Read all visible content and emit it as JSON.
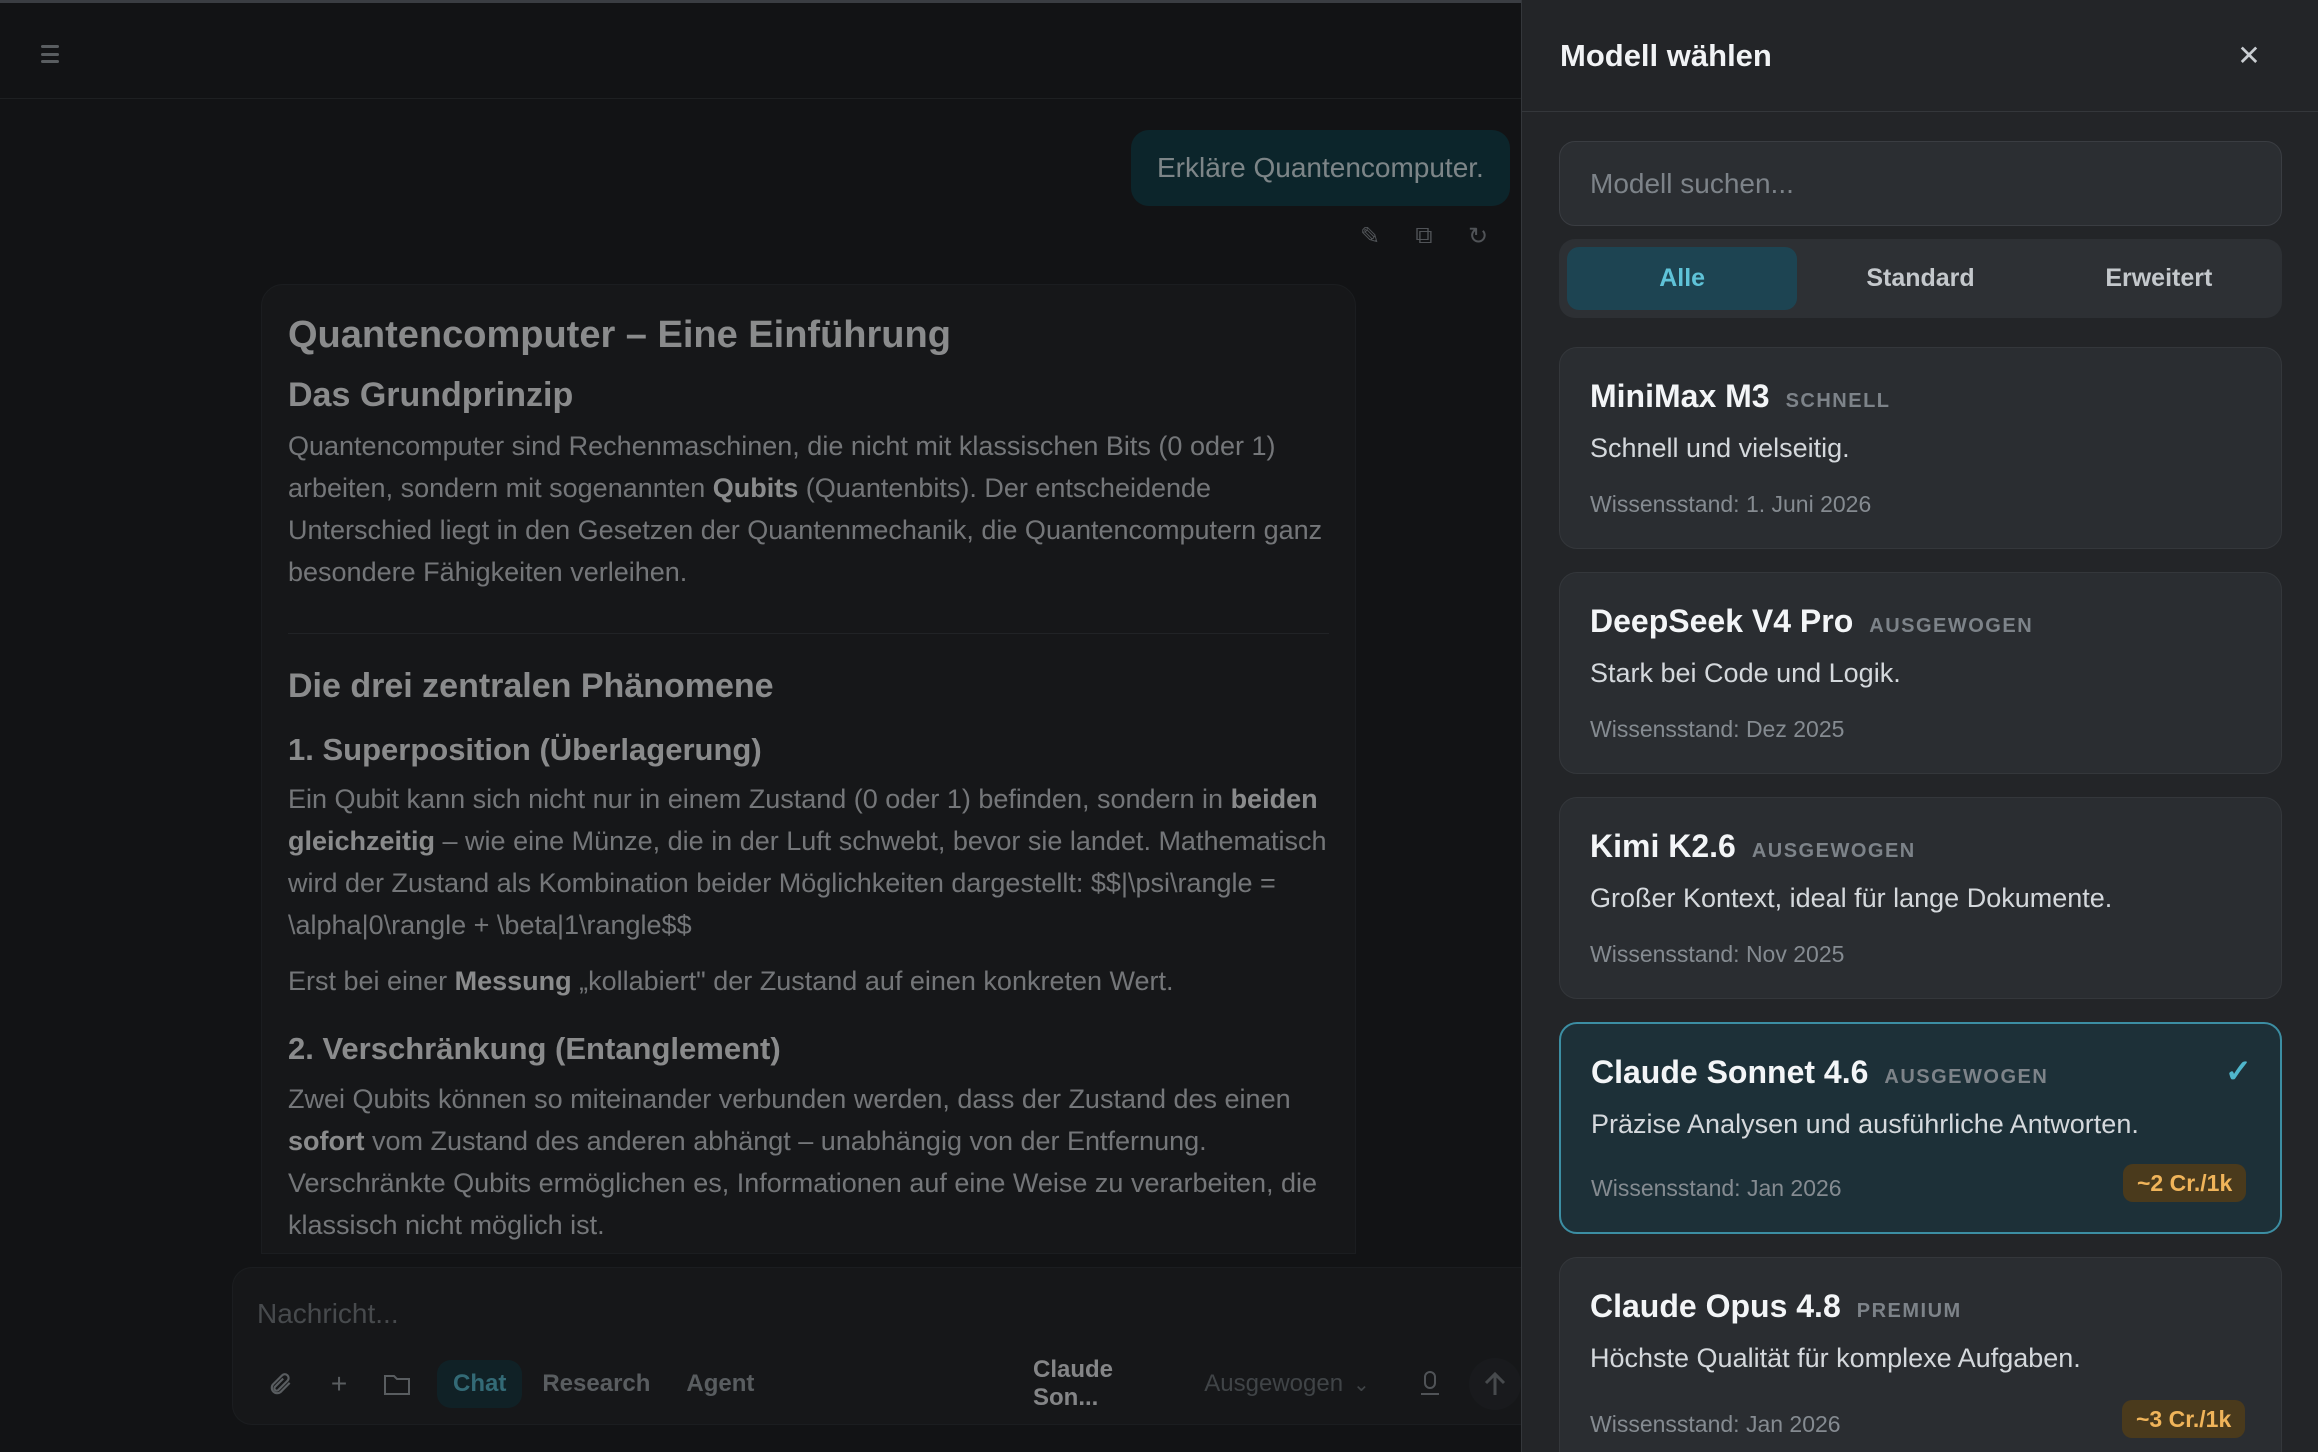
{
  "chat": {
    "user_message": "Erkläre Quantencomputer.",
    "answer": {
      "title": "Quantencomputer – Eine Einführung",
      "section1_title": "Das Grundprinzip",
      "p1_a": "Quantencomputer sind Rechenmaschinen, die nicht mit klassischen Bits (0 oder 1) arbeiten, sondern mit sogenannten ",
      "p1_bold": "Qubits",
      "p1_b": " (Quantenbits). Der entscheidende Unterschied liegt in den Gesetzen der Quantenmechanik, die Quantencomputern ganz besondere Fähigkeiten verleihen.",
      "section2_title": "Die drei zentralen Phänomene",
      "sub1_title": "1. Superposition (Überlagerung)",
      "p2_a": "Ein Qubit kann sich nicht nur in einem Zustand (0 oder 1) befinden, sondern in ",
      "p2_bold": "beiden gleichzeitig",
      "p2_b": " – wie eine Münze, die in der Luft schwebt, bevor sie landet. Mathematisch wird der Zustand als Kombination beider Möglichkeiten dargestellt: $$|\\psi\\rangle = \\alpha|0\\rangle + \\beta|1\\rangle$$",
      "p3_a": "Erst bei einer ",
      "p3_bold": "Messung",
      "p3_b": " „kollabiert\" der Zustand auf einen konkreten Wert.",
      "sub2_title": "2. Verschränkung (Entanglement)",
      "p4_a": "Zwei Qubits können so miteinander verbunden werden, dass der Zustand des einen ",
      "p4_bold": "sofort",
      "p4_b": " vom Zustand des anderen abhängt – unabhängig von der Entfernung. Verschränkte Qubits ermöglichen es, Informationen auf eine Weise zu verarbeiten, die klassisch nicht möglich ist."
    }
  },
  "composer": {
    "placeholder": "Nachricht...",
    "modes": [
      "Chat",
      "Research",
      "Agent"
    ],
    "active_mode": "Chat",
    "model_name": "Claude Son...",
    "model_mode": "Ausgewogen"
  },
  "panel": {
    "title": "Modell wählen",
    "search_placeholder": "Modell suchen...",
    "tabs": [
      "Alle",
      "Standard",
      "Erweitert"
    ],
    "active_tab": "Alle",
    "models": [
      {
        "name": "MiniMax M3",
        "tag": "SCHNELL",
        "desc": "Schnell und vielseitig.",
        "date": "Wissensstand: 1. Juni 2026"
      },
      {
        "name": "DeepSeek V4 Pro",
        "tag": "AUSGEWOGEN",
        "desc": "Stark bei Code und Logik.",
        "date": "Wissensstand: Dez 2025"
      },
      {
        "name": "Kimi K2.6",
        "tag": "AUSGEWOGEN",
        "desc": "Großer Kontext, ideal für lange Dokumente.",
        "date": "Wissensstand: Nov 2025"
      },
      {
        "name": "Claude Sonnet 4.6",
        "tag": "AUSGEWOGEN",
        "desc": "Präzise Analysen und ausführliche Antworten.",
        "date": "Wissensstand: Jan 2026",
        "cost": "~2 Cr./1k",
        "selected": true
      },
      {
        "name": "Claude Opus 4.8",
        "tag": "PREMIUM",
        "desc": "Höchste Qualität für komplexe Aufgaben.",
        "date": "Wissensstand: Jan 2026",
        "cost": "~3 Cr./1k"
      }
    ]
  },
  "colors": {
    "accent": "#4fb6cc",
    "cost_text": "#f0b45a",
    "cost_bg": "#4a3a1c",
    "selected_border": "#3c8ea3"
  }
}
